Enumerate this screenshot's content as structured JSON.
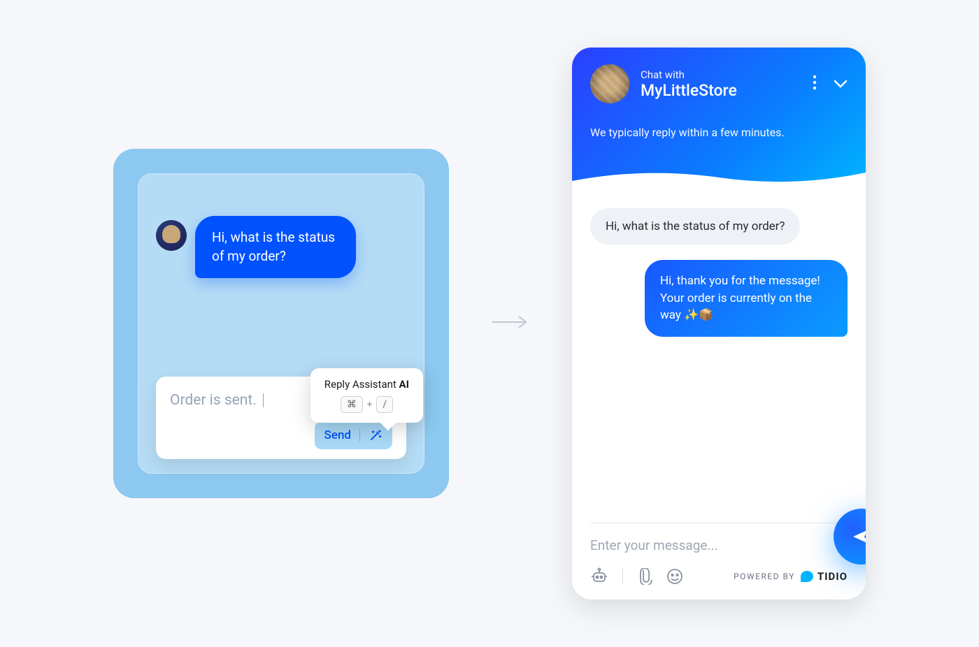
{
  "agent": {
    "customer_message": "Hi, what is the status of my order?",
    "compose_text": "Order is sent.",
    "send_label": "Send",
    "tooltip_prefix": "Reply Assistant ",
    "tooltip_bold": "AI",
    "kbd_cmd": "⌘",
    "kbd_plus": "+",
    "kbd_slash": "/"
  },
  "chat": {
    "chat_with_label": "Chat with",
    "store_name": "MyLittleStore",
    "reply_time": "We typically reply within a few minutes.",
    "incoming": "Hi, what is the status of my order?",
    "outgoing": "Hi, thank you for the message! Your order is currently on the way ✨📦",
    "input_placeholder": "Enter your message...",
    "powered_label": "POWERED BY",
    "brand_name": "TIDIO"
  }
}
